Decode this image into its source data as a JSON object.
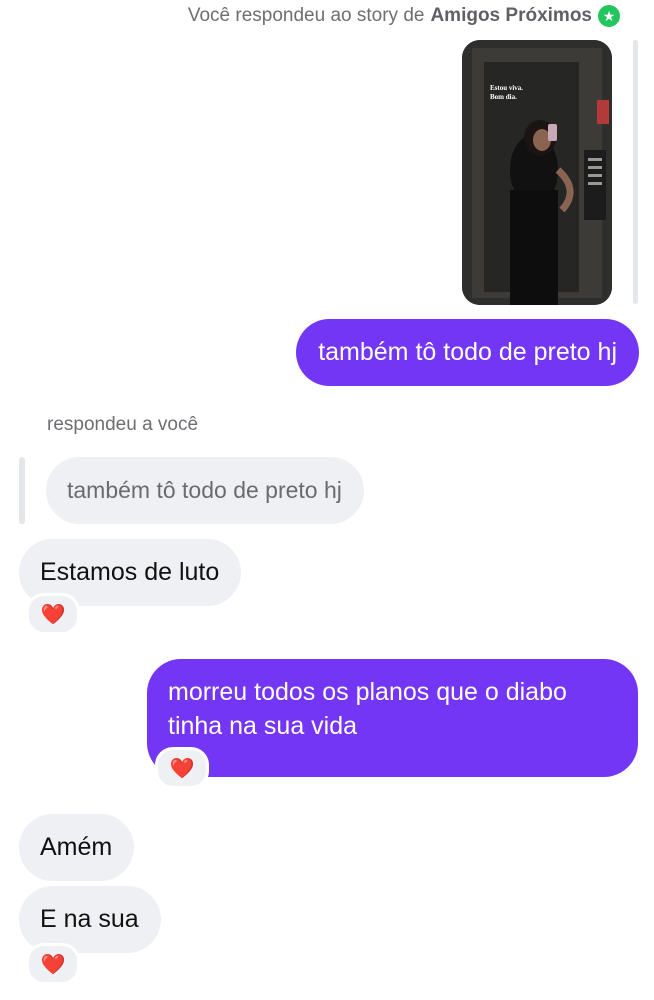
{
  "story_reply": {
    "prefix": "Você respondeu ao story de",
    "audience": "Amigos Próximos",
    "badge_icon": "star-icon",
    "story_text_line1": "Estou viva.",
    "story_text_line2": "Bom dia."
  },
  "messages": {
    "m1": "também tô todo de preto hj",
    "reply_label": "respondeu a você",
    "quoted": "também tô todo de preto hj",
    "m2": "Estamos de luto",
    "m3": "morreu todos os planos que o diabo tinha na sua vida",
    "m4": "Amém",
    "m5": "E na sua"
  },
  "reactions": {
    "heart": "❤️"
  },
  "colors": {
    "accent": "#7436f5",
    "incoming_bubble": "#eff0f3",
    "badge": "#22c55e"
  }
}
